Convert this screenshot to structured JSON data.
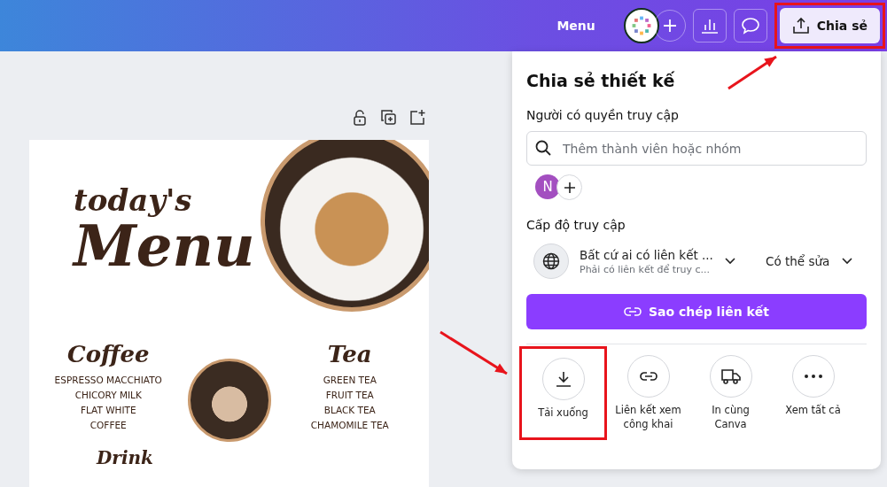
{
  "topbar": {
    "menu_label": "Menu",
    "share_button": {
      "label": "Chia sẻ",
      "highlighted": true
    }
  },
  "design": {
    "subtitle": "today's",
    "title": "Menu",
    "sections": [
      {
        "heading": "Coffee",
        "items": [
          "ESPRESSO MACCHIATO",
          "CHICORY MILK",
          "FLAT WHITE",
          "COFFEE"
        ]
      },
      {
        "heading": "Tea",
        "items": [
          "GREEN TEA",
          "FRUIT TEA",
          "BLACK TEA",
          "CHAMOMILE TEA"
        ]
      }
    ],
    "next_heading": "Drink"
  },
  "share_panel": {
    "title": "Chia sẻ thiết kế",
    "people_label": "Người có quyền truy cập",
    "search": {
      "placeholder": "Thêm thành viên hoặc nhóm"
    },
    "member_initial": "N",
    "access_label": "Cấp độ truy cập",
    "access": {
      "title": "Bất cứ ai có liên kết ...",
      "subtitle": "Phải có liên kết để truy c...",
      "permission": "Có thể sửa"
    },
    "copy_button": "Sao chép liên kết",
    "actions": [
      {
        "kind": "download",
        "label": "Tải xuống",
        "highlighted": true
      },
      {
        "kind": "link",
        "label": "Liên kết xem công khai",
        "highlighted": false
      },
      {
        "kind": "print",
        "label": "In cùng Canva",
        "highlighted": false
      },
      {
        "kind": "more",
        "label": "Xem tất cả",
        "highlighted": false
      }
    ]
  }
}
